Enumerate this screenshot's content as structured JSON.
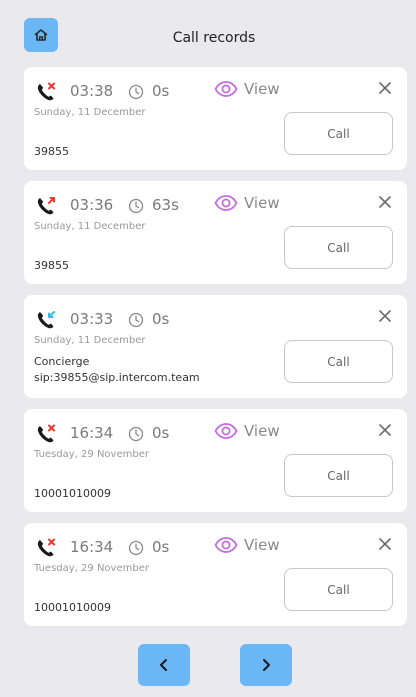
{
  "header": {
    "title": "Call records",
    "home_icon": "home-icon"
  },
  "records": [
    {
      "status": "missed",
      "time": "03:38",
      "duration": "0s",
      "has_view": true,
      "view_label": "View",
      "date": "Sunday, 11 December",
      "number": "39855",
      "call_label": "Call"
    },
    {
      "status": "outgoing",
      "time": "03:36",
      "duration": "63s",
      "has_view": true,
      "view_label": "View",
      "date": "Sunday, 11 December",
      "number": "39855",
      "call_label": "Call"
    },
    {
      "status": "incoming",
      "time": "03:33",
      "duration": "0s",
      "has_view": false,
      "date": "Sunday, 11 December",
      "name": "Concierge",
      "sip": "sip:39855@sip.intercom.team",
      "call_label": "Call"
    },
    {
      "status": "missed",
      "time": "16:34",
      "duration": "0s",
      "has_view": true,
      "view_label": "View",
      "date": "Tuesday, 29 November",
      "number": "10001010009",
      "call_label": "Call"
    },
    {
      "status": "missed",
      "time": "16:34",
      "duration": "0s",
      "has_view": true,
      "view_label": "View",
      "date": "Tuesday, 29 November",
      "number": "10001010009",
      "call_label": "Call"
    }
  ],
  "pagination": {
    "prev_icon": "chevron-left-icon",
    "next_icon": "chevron-right-icon"
  },
  "colors": {
    "accent": "#6bb6f4",
    "missed": "#e53935",
    "outgoing": "#e53935",
    "incoming": "#3db7e8",
    "view": "#c36ee0",
    "background": "#e9e9ee"
  }
}
